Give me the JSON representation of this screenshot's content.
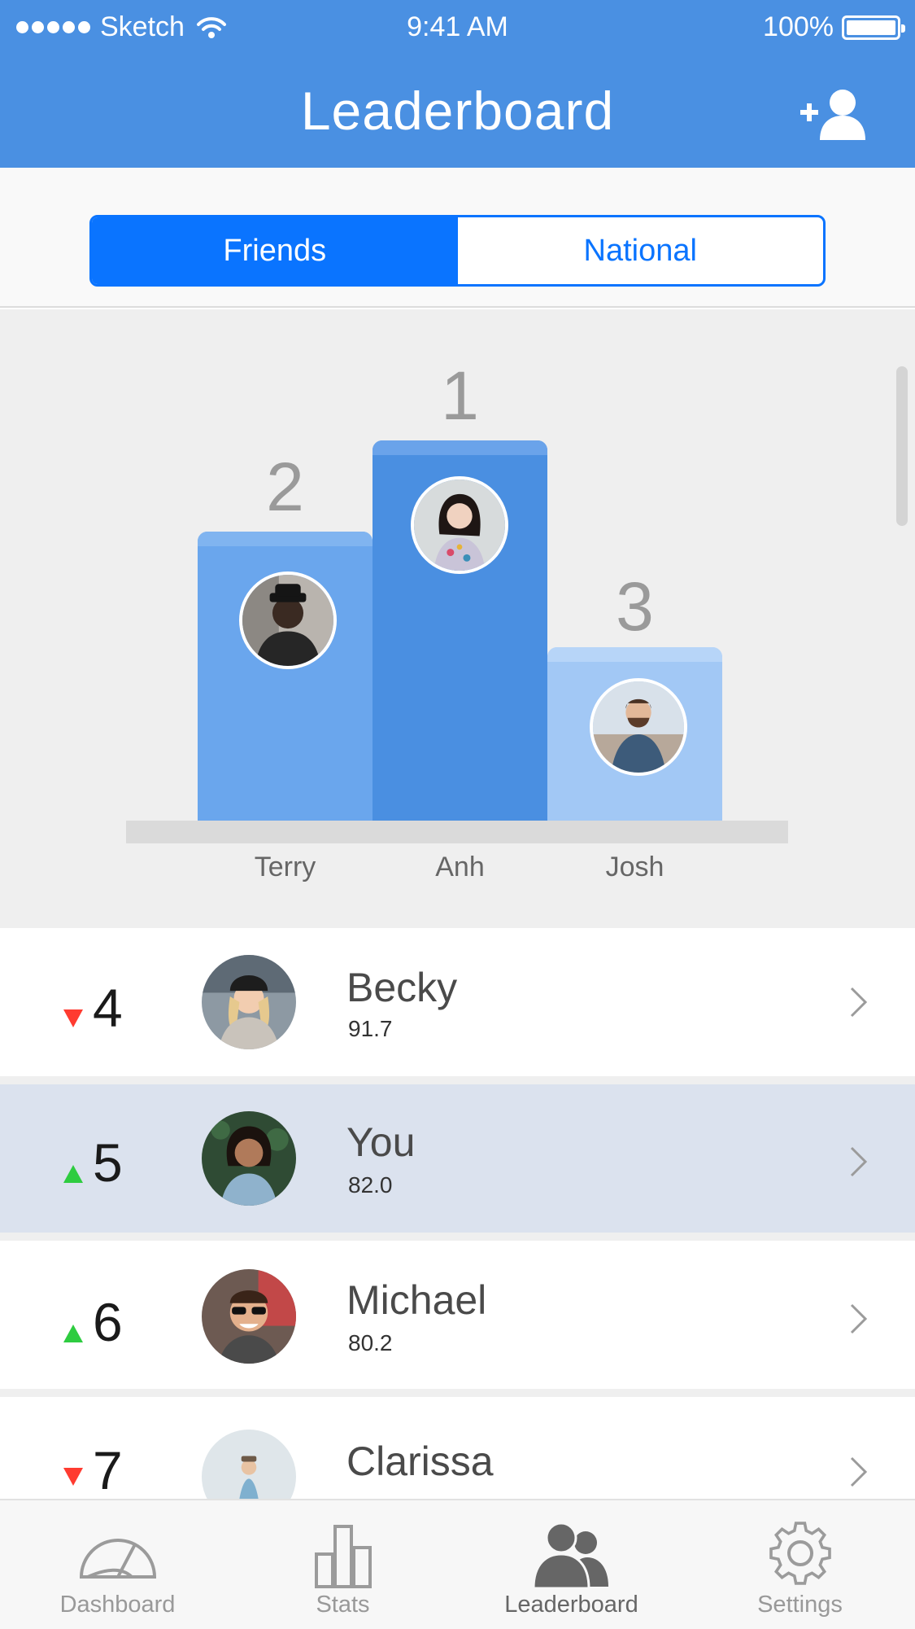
{
  "status_bar": {
    "carrier": "Sketch",
    "time": "9:41 AM",
    "battery": "100%"
  },
  "header": {
    "title": "Leaderboard",
    "add_icon": "add-user-icon"
  },
  "segment": {
    "options": [
      "Friends",
      "National"
    ],
    "selected": "Friends"
  },
  "podium": [
    {
      "rank": "1",
      "name": "Anh"
    },
    {
      "rank": "2",
      "name": "Terry"
    },
    {
      "rank": "3",
      "name": "Josh"
    }
  ],
  "list": [
    {
      "rank": "4",
      "trend": "down",
      "name": "Becky",
      "score": "91.7"
    },
    {
      "rank": "5",
      "trend": "up",
      "name": "You",
      "score": "82.0"
    },
    {
      "rank": "6",
      "trend": "up",
      "name": "Michael",
      "score": "80.2"
    },
    {
      "rank": "7",
      "trend": "down",
      "name": "Clarissa",
      "score": ""
    }
  ],
  "tabbar": {
    "tabs": [
      {
        "label": "Dashboard",
        "icon": "gauge-icon"
      },
      {
        "label": "Stats",
        "icon": "bar-chart-icon"
      },
      {
        "label": "Leaderboard",
        "icon": "people-icon"
      },
      {
        "label": "Settings",
        "icon": "gear-icon"
      }
    ],
    "active": "Leaderboard"
  },
  "colors": {
    "header": "#4a90e2",
    "segment_accent": "#0a74ff",
    "trend_up": "#2ecc40",
    "trend_down": "#ff3b30"
  }
}
